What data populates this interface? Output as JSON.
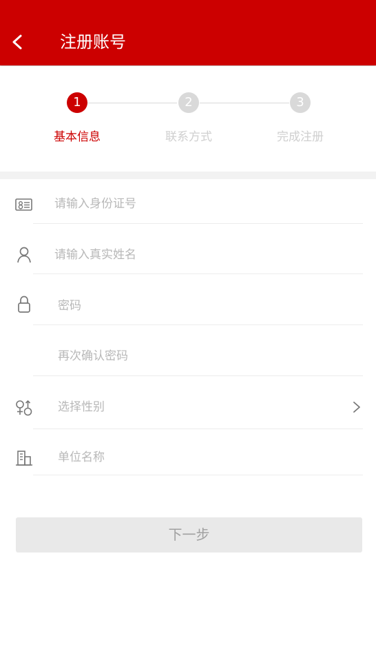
{
  "header": {
    "title": "注册账号"
  },
  "steps": [
    {
      "number": "1",
      "label": "基本信息",
      "state": "active"
    },
    {
      "number": "2",
      "label": "联系方式",
      "state": "inactive"
    },
    {
      "number": "3",
      "label": "完成注册",
      "state": "inactive"
    }
  ],
  "form": {
    "id_number": {
      "placeholder": "请输入身份证号",
      "icon": "id-card-icon"
    },
    "real_name": {
      "placeholder": "请输入真实姓名",
      "icon": "user-icon"
    },
    "password": {
      "placeholder": "密码",
      "icon": "lock-icon"
    },
    "confirm_password": {
      "placeholder": "再次确认密码"
    },
    "gender": {
      "placeholder": "选择性别",
      "icon": "gender-icon"
    },
    "company": {
      "placeholder": "单位名称",
      "icon": "building-icon"
    }
  },
  "next_button": {
    "label": "下一步"
  },
  "colors": {
    "primary": "#cc0000",
    "inactive_step": "#d9d9d9",
    "placeholder": "#b8b8b8",
    "button_bg": "#e9e9e9"
  }
}
